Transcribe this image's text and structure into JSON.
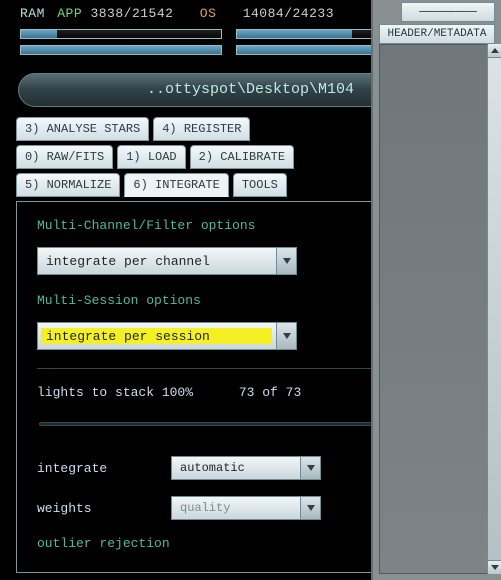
{
  "mem": {
    "ram_label": "RAM",
    "app_label": "APP",
    "app_value": "3838/21542",
    "os_label": "OS",
    "os_value": "14084/24233"
  },
  "path": "..ottyspot\\Desktop\\M104",
  "tabs": {
    "row1": [
      "3) ANALYSE STARS",
      "4) REGISTER"
    ],
    "row2": [
      "0) RAW/FITS",
      "1) LOAD",
      "2) CALIBRATE"
    ],
    "row3": [
      "5) NORMALIZE",
      "6) INTEGRATE",
      "TOOLS"
    ]
  },
  "panel": {
    "multichannel_title": "Multi-Channel/Filter options",
    "channel_select": "integrate per channel",
    "multisession_title": "Multi-Session options",
    "session_select": "integrate per session",
    "stack_label": "lights to stack 100%",
    "stack_count": "73 of 73",
    "integrate_label": "integrate",
    "integrate_value": "automatic",
    "weights_label": "weights",
    "weights_value": "quality",
    "outlier_title": "outlier rejection"
  },
  "right": {
    "tab_top": "────────",
    "tab_main": "HEADER/METADATA"
  }
}
